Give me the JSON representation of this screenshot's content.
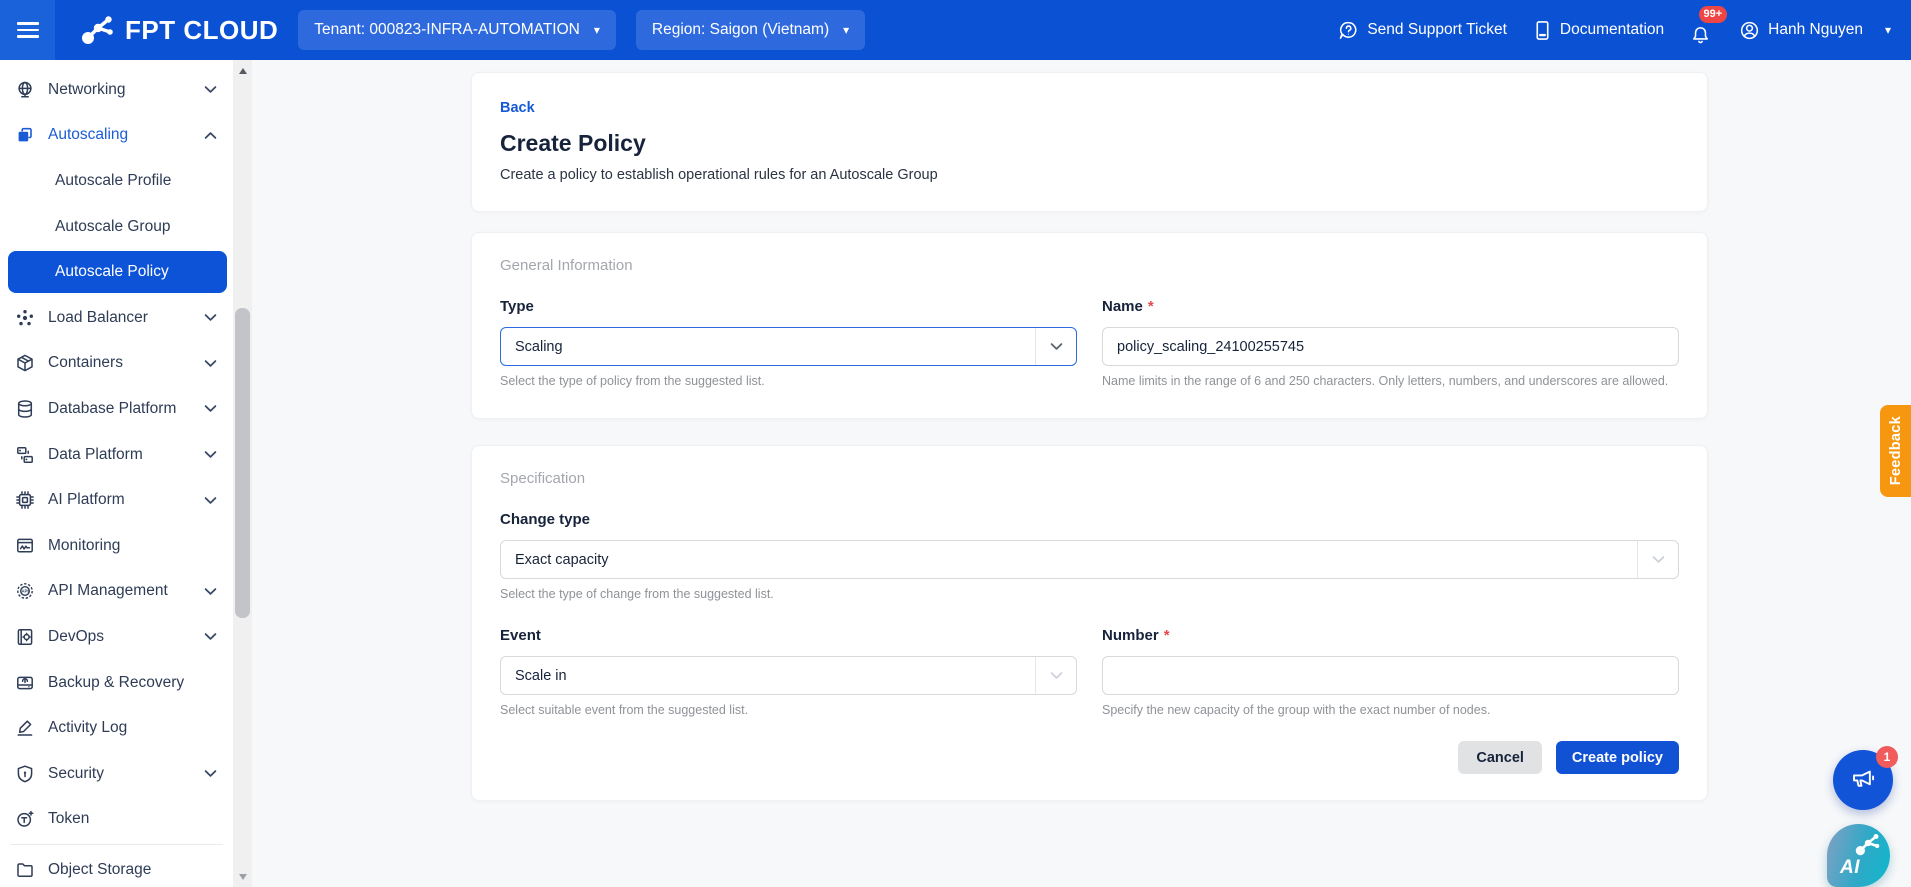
{
  "header": {
    "brand": "FPT CLOUD",
    "tenant": "Tenant: 000823-INFRA-AUTOMATION",
    "region": "Region: Saigon (Vietnam)",
    "support": "Send Support Ticket",
    "docs": "Documentation",
    "notif_badge": "99+",
    "user": "Hanh Nguyen"
  },
  "sidebar": {
    "items": [
      {
        "label": "Networking",
        "icon": "globe",
        "chevron": "down"
      },
      {
        "label": "Autoscaling",
        "icon": "autoscale",
        "chevron": "up",
        "highlight": true
      },
      {
        "label": "Autoscale Profile",
        "sub": true
      },
      {
        "label": "Autoscale Group",
        "sub": true
      },
      {
        "label": "Autoscale Policy",
        "sub": true,
        "selected": true
      },
      {
        "label": "Load Balancer",
        "icon": "loadbalancer",
        "chevron": "down"
      },
      {
        "label": "Containers",
        "icon": "box",
        "chevron": "down"
      },
      {
        "label": "Database Platform",
        "icon": "database",
        "chevron": "down"
      },
      {
        "label": "Data Platform",
        "icon": "dataplatform",
        "chevron": "down"
      },
      {
        "label": "AI Platform",
        "icon": "chip",
        "chevron": "down"
      },
      {
        "label": "Monitoring",
        "icon": "monitor"
      },
      {
        "label": "API Management",
        "icon": "api",
        "chevron": "down"
      },
      {
        "label": "DevOps",
        "icon": "devops",
        "chevron": "down"
      },
      {
        "label": "Backup & Recovery",
        "icon": "backup"
      },
      {
        "label": "Activity Log",
        "icon": "activity"
      },
      {
        "label": "Security",
        "icon": "shield",
        "chevron": "down"
      },
      {
        "label": "Token",
        "icon": "token"
      },
      {
        "divider": true
      },
      {
        "label": "Object Storage",
        "icon": "folder"
      }
    ]
  },
  "page": {
    "back": "Back",
    "title": "Create Policy",
    "subtitle": "Create a policy to establish operational rules for an Autoscale Group"
  },
  "general": {
    "section": "General Information",
    "type_label": "Type",
    "type_value": "Scaling",
    "type_help": "Select the type of policy from the suggested list.",
    "name_label": "Name",
    "required_mark": "*",
    "name_value": "policy_scaling_24100255745",
    "name_help": "Name limits in the range of 6 and 250 characters. Only letters, numbers, and underscores are allowed."
  },
  "spec": {
    "section": "Specification",
    "change_label": "Change type",
    "change_value": "Exact capacity",
    "change_help": "Select the type of change from the suggested list.",
    "event_label": "Event",
    "event_value": "Scale in",
    "event_help": "Select suitable event from the suggested list.",
    "number_label": "Number",
    "required_mark": "*",
    "number_help": "Specify the new capacity of the group with the exact number of nodes.",
    "cancel": "Cancel",
    "submit": "Create policy"
  },
  "feedback_tab": "Feedback",
  "floating": {
    "announce_badge": "1",
    "ai_label": "AI"
  },
  "colors": {
    "header_blue": "#0b51d4",
    "pill_blue": "#2e6ade",
    "selected_blue": "#0d53d7",
    "link_blue": "#1659d6",
    "button_blue": "#1152d4",
    "feedback_orange": "#f7970f",
    "badge_red": "#ee4545",
    "required_red": "#e5484d"
  }
}
